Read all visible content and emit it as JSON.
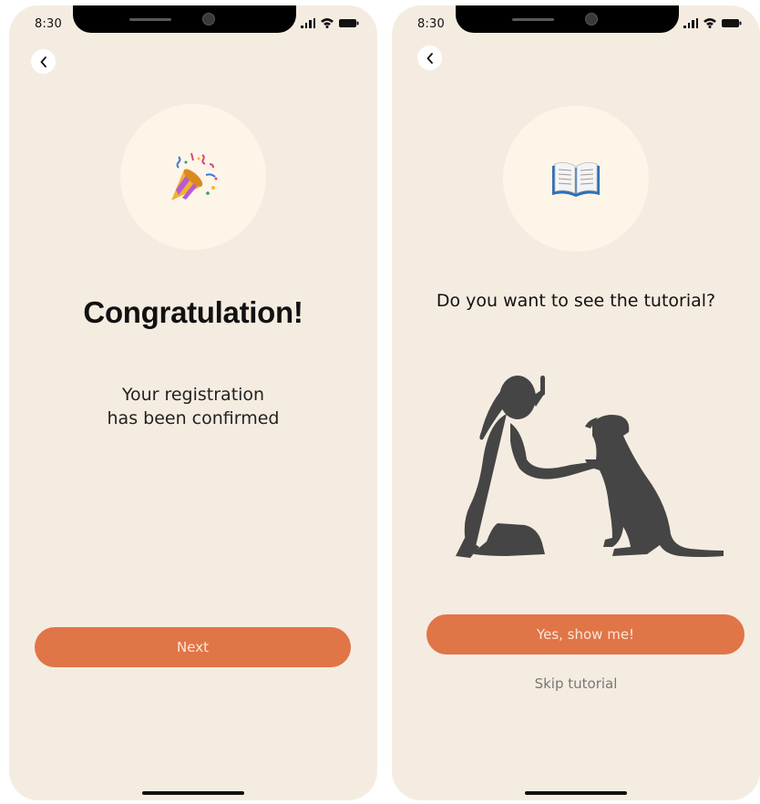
{
  "status_bar": {
    "time": "8:30"
  },
  "screens": [
    {
      "icon": "party-popper-icon",
      "title": "Congratulation!",
      "subtitle_lines": [
        "Your registration",
        "has been confirmed"
      ],
      "primary_button": "Next"
    },
    {
      "icon": "open-book-icon",
      "question": "Do you want to see the tutorial?",
      "illustration": "woman-training-dog-silhouette",
      "primary_button": "Yes, show me!",
      "secondary_link": "Skip tutorial"
    }
  ],
  "colors": {
    "background": "#f5ece1",
    "accent": "#e07548",
    "circle": "#fdf5e8",
    "silhouette": "#454545"
  }
}
